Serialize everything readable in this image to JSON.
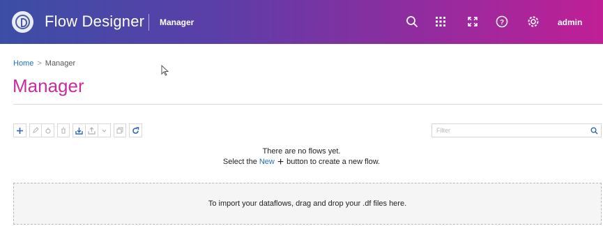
{
  "header": {
    "app_title": "Flow Designer",
    "subtitle": "Manager",
    "user": "admin",
    "gradient_start": "#3b4ea6",
    "gradient_end": "#c01f96",
    "icons": [
      "search-icon",
      "apps-grid-icon",
      "fullscreen-icon",
      "help-icon",
      "settings-icon"
    ]
  },
  "breadcrumb": {
    "home": "Home",
    "separator": ">",
    "current": "Manager"
  },
  "page": {
    "title": "Manager",
    "title_color": "#c62ea0"
  },
  "toolbar": {
    "buttons": [
      "add-icon",
      "edit-icon",
      "run-icon",
      "delete-icon",
      "import-icon",
      "export-icon",
      "export-dropdown-icon",
      "duplicate-icon",
      "refresh-icon"
    ]
  },
  "filter": {
    "placeholder": "Filter",
    "value": ""
  },
  "empty_state": {
    "line1": "There are no flows yet.",
    "line2_prefix": "Select the",
    "new_link": "New",
    "plus": "+",
    "line2_suffix": "button to create a new flow."
  },
  "dropzone": {
    "text": "To import your dataflows, drag and drop your .df files here."
  }
}
